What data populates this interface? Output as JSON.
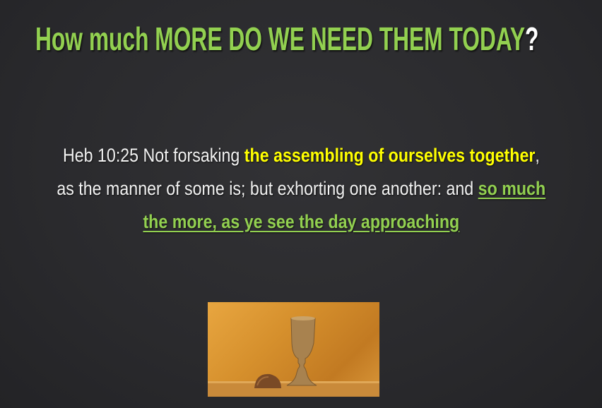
{
  "title": {
    "part1": "How much ",
    "part2": "MORE DO WE NEED THEM TODAY",
    "question_mark": "?"
  },
  "verse": {
    "line1_plain": "Heb 10:25  Not forsaking ",
    "line1_highlight": "the assembling of ourselves together",
    "line1_end": ",",
    "line2_plain": "as the manner of some is; but exhorting one another: and ",
    "line2_highlight": "so much",
    "line3_highlight": "the more, as ye see the day approaching"
  },
  "colors": {
    "green": "#92d050",
    "yellow": "#ffff00",
    "background": "#2b2b2e"
  },
  "image": {
    "subject": "communion-cup-and-bread"
  }
}
